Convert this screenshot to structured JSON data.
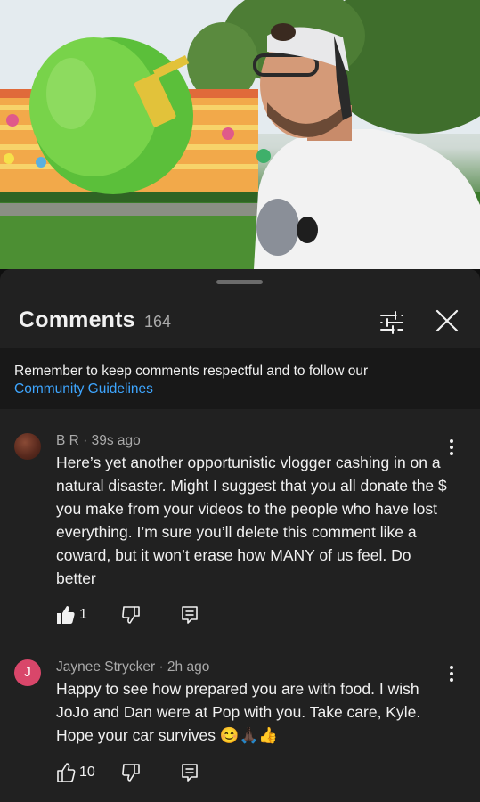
{
  "comments_panel": {
    "title": "Comments",
    "count": "164",
    "filter_icon": "sliders-icon",
    "close_icon": "close-icon"
  },
  "notice": {
    "text": "Remember to keep comments respectful and to follow our",
    "link": "Community Guidelines",
    "link_color": "#3ea6ff"
  },
  "comments": [
    {
      "author": "B R",
      "time": "39s ago",
      "text": "Here’s yet another opportunistic vlogger cashing in on a natural disaster. Might I suggest that you all donate the $ you make from your videos to the people who have lost everything. I’m sure you’ll delete this comment like a coward, but it won’t erase how MANY of us feel. Do better",
      "likes": "1",
      "liked": true
    },
    {
      "author": "Jaynee Strycker",
      "avatar_letter": "J",
      "avatar_color": "#d9466a",
      "time": "2h ago",
      "text": "Happy to see how prepared you are with food. I wish JoJo and Dan were at Pop with you. Take care, Kyle. Hope your car survives 😊🙏🏿👍",
      "likes": "10",
      "liked": false
    }
  ],
  "colors": {
    "sheet_bg": "#212121",
    "notice_bg": "#181818",
    "secondary_text": "#aaaaaa"
  }
}
